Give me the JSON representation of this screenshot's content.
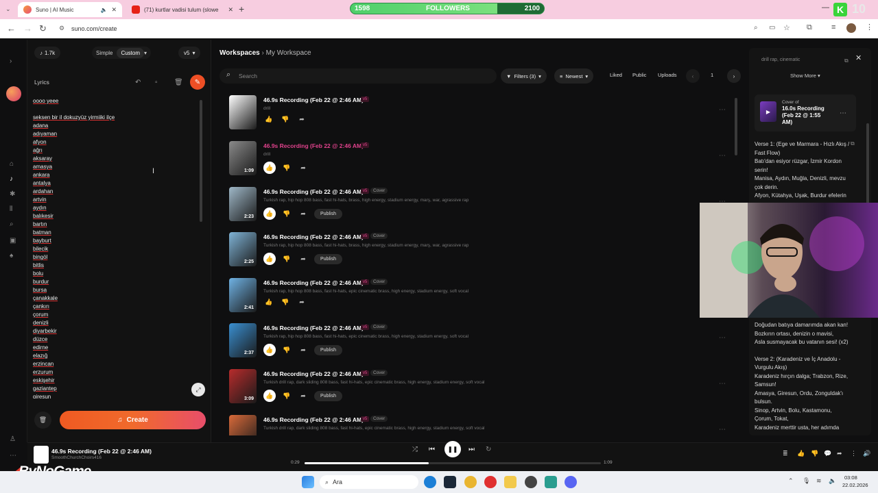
{
  "browser": {
    "tabs": [
      {
        "label": "Suno | AI Music",
        "active": true
      },
      {
        "label": "(71) kurtlar vadisi tulum (slowe",
        "active": false
      }
    ],
    "url": "suno.com/create"
  },
  "followers_widget": {
    "current": "1598",
    "label": "FOLLOWERS",
    "goal": "2100",
    "progress": 0.76,
    "side_badge": "10"
  },
  "create_panel": {
    "credits": "1.7k",
    "mode_simple": "Simple",
    "mode_custom": "Custom",
    "model": "v5",
    "lyrics_label": "Lyrics",
    "lyrics_lines": [
      "oooo yeee",
      "",
      "seksen bir il dokuzyüz yirmiiki ilçe",
      "adana",
      "adıyaman",
      "afyon",
      "ağrı",
      "aksaray",
      "amasya",
      "ankara",
      "antalya",
      "ardahan",
      "artvin",
      "aydın",
      "balıkesir",
      "bartın",
      "batman",
      "bayburt",
      "bilecik",
      "bingöl",
      "bitlis",
      "bolu",
      "burdur",
      "bursa",
      "çanakkale",
      "çankırı",
      "çorum",
      "denizli",
      "diyarbekir",
      "düzce",
      "edirne",
      "elazığ",
      "erzincan",
      "erzurum",
      "eskişehir",
      "gaziantep",
      "giresun"
    ],
    "create_label": "Create"
  },
  "workspace": {
    "breadcrumb_root": "Workspaces",
    "breadcrumb_current": "My Workspace",
    "search_placeholder": "Search",
    "filters_label": "Filters (3)",
    "sort_label": "Newest",
    "chip_liked": "Liked",
    "chip_public": "Public",
    "chip_uploads": "Uploads",
    "page": "1"
  },
  "songs": [
    {
      "title": "46.9s Recording (Feb 22 @ 2:46 AM)",
      "version": "v5",
      "cover": "",
      "style": "drill",
      "duration": "",
      "publish": "",
      "highlight": false,
      "thumb": "#ffffff"
    },
    {
      "title": "46.9s Recording (Feb 22 @ 2:46 AM)",
      "version": "v5",
      "cover": "",
      "style": "drill",
      "duration": "1:09",
      "publish": "",
      "highlight": true,
      "thumb": "#8a8a8a"
    },
    {
      "title": "46.9s Recording (Feb 22 @ 2:46 AM)",
      "version": "v5",
      "cover": "Cover",
      "style": "Turkish rap, hip hop 808 bass, fast hi-hats, brass, high energy, stadium energy, marş, war, agrassive rap",
      "duration": "2:23",
      "publish": "Publish",
      "highlight": false,
      "thumb": "#9fb8c8"
    },
    {
      "title": "46.9s Recording (Feb 22 @ 2:46 AM)",
      "version": "v5",
      "cover": "Cover",
      "style": "Turkish rap, hip hop 808 bass, fast hi-hats, brass, high energy, stadium energy, marş, war, agrassive rap",
      "duration": "2:25",
      "publish": "Publish",
      "highlight": false,
      "thumb": "#7fb3d6"
    },
    {
      "title": "46.9s Recording (Feb 22 @ 2:46 AM)",
      "version": "v5",
      "cover": "Cover",
      "style": "Turkish rap, hip hop 808 bass, fast hi-hats, epic cinematic brass, high energy, stadium energy, soft vocal",
      "duration": "2:41",
      "publish": "",
      "highlight": false,
      "thumb": "#6fb2e4"
    },
    {
      "title": "46.9s Recording (Feb 22 @ 2:46 AM)",
      "version": "v5",
      "cover": "Cover",
      "style": "Turkish rap, hip hop 808 bass, fast hi-hats, epic cinematic brass, high energy, stadium energy, soft vocal",
      "duration": "2:37",
      "publish": "Publish",
      "highlight": false,
      "thumb": "#3a8fd1"
    },
    {
      "title": "46.9s Recording (Feb 22 @ 2:46 AM)",
      "version": "v5",
      "cover": "Cover",
      "style": "Turkish drill rap, dark sliding 808 bass, fast hi-hats, epic cinematic brass, high energy, stadium energy, soft vocal",
      "duration": "3:09",
      "publish": "Publish",
      "highlight": false,
      "thumb": "#b82c2c"
    },
    {
      "title": "46.9s Recording (Feb 22 @ 2:46 AM)",
      "version": "v5",
      "cover": "Cover",
      "style": "Turkish drill rap, dark sliding 808 bass, fast hi-hats, epic cinematic brass, high energy, stadium energy, soft vocal",
      "duration": "",
      "publish": "",
      "highlight": false,
      "thumb": "#d96a3a"
    }
  ],
  "right_panel": {
    "tag_text": "drill rap, cinematic",
    "show_more": "Show More",
    "cover_of": "Cover of",
    "cover_title": "16.0s Recording (Feb 22 @ 1:55 AM)",
    "lyrics_top": [
      "Verse 1: (Ege ve Marmara - Hızlı Akış / Fast Flow)",
      "Batı'dan esiyor rüzgar, İzmir Kordon serin!",
      "Manisa, Aydın, Muğla, Denizli, mevzu çok derin.",
      "Afyon, Kütahya, Uşak, Burdur efelerin"
    ],
    "lyrics_bottom": [
      "Doğudan batıya damarımda akan kan!",
      "Bozkırın ortası, denizin o mavisi,",
      "Asla susmayacak bu vatanın sesi! (x2)",
      "",
      "Verse 2: (Karadeniz ve İç Anadolu - Vurgulu Akış)",
      "Karadeniz hırçın dalga; Trabzon, Rize, Samsun!",
      "Amasya, Giresun, Ordu, Zonguldak'ı bulsun.",
      "Sinop, Artvin, Bolu, Kastamonu, Çorum, Tokat,",
      "Karadeniz merttir usta, her adımda"
    ]
  },
  "player": {
    "title": "46.9s Recording (Feb 22 @ 2:46 AM)",
    "artist": "SmoothChurchChoirs416",
    "elapsed": "0:29",
    "total": "1:09",
    "progress": 0.42
  },
  "watermark": "ByNoGame",
  "taskbar": {
    "search_label": "Ara",
    "time": "03:08",
    "date": "22.02.2026"
  },
  "colors": {
    "accent": "#ef5a22",
    "pink": "#e0428c",
    "bg": "#0f0f10"
  }
}
